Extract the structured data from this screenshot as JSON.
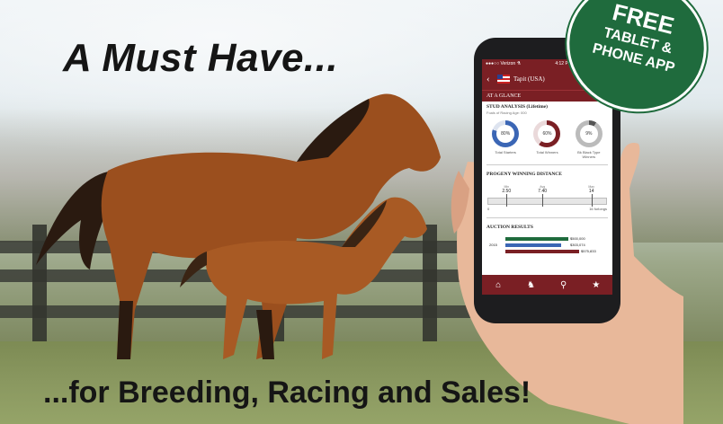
{
  "headline": "A Must Have...",
  "tagline": "...for Breeding, Racing and Sales!",
  "badge": {
    "line1": "FREE",
    "line2": "TABLET &",
    "line3": "PHONE APP",
    "color": "#1f6b3d"
  },
  "phone": {
    "status": {
      "carrier": "●●●○○ Verizon ⚗",
      "time": "4:12 PM",
      "battery": "▮"
    },
    "nav": {
      "back": "‹",
      "title": "Tapit (USA)",
      "subtitle": "",
      "gear": "⚙"
    },
    "glance": {
      "label": "AT A GLANCE",
      "star": "☆",
      "menu": "☰"
    },
    "stud": {
      "title": "STUD ANALYSIS (Lifetime)",
      "subtitle": "Foals of Racing Age: 000",
      "rings": [
        {
          "value": "80%",
          "caption": "Total Starters",
          "color": "#3b66b5"
        },
        {
          "value": "60%",
          "caption": "Total Winners",
          "color": "#7a1f24"
        },
        {
          "value": "9%",
          "caption": "Bk Black Type Winners",
          "color": "#888888"
        }
      ]
    },
    "progeny": {
      "title": "PROGENY WINNING DISTANCE",
      "ticks": [
        {
          "top": "Min",
          "value": "2.50"
        },
        {
          "top": "Avg",
          "value": "7.40"
        },
        {
          "top": "Max",
          "value": "14"
        }
      ],
      "start": "0",
      "end": "16 furlongs"
    },
    "auction": {
      "title": "AUCTION RESULTS",
      "year": "2015",
      "values": [
        "$500,000",
        "$303,074",
        "$575,833"
      ],
      "colors": [
        "#1f6b3d",
        "#3b66b5",
        "#7a1f24"
      ]
    },
    "tabs": [
      "home",
      "horse",
      "search",
      "favorites"
    ],
    "accent": "#7a1f24"
  }
}
